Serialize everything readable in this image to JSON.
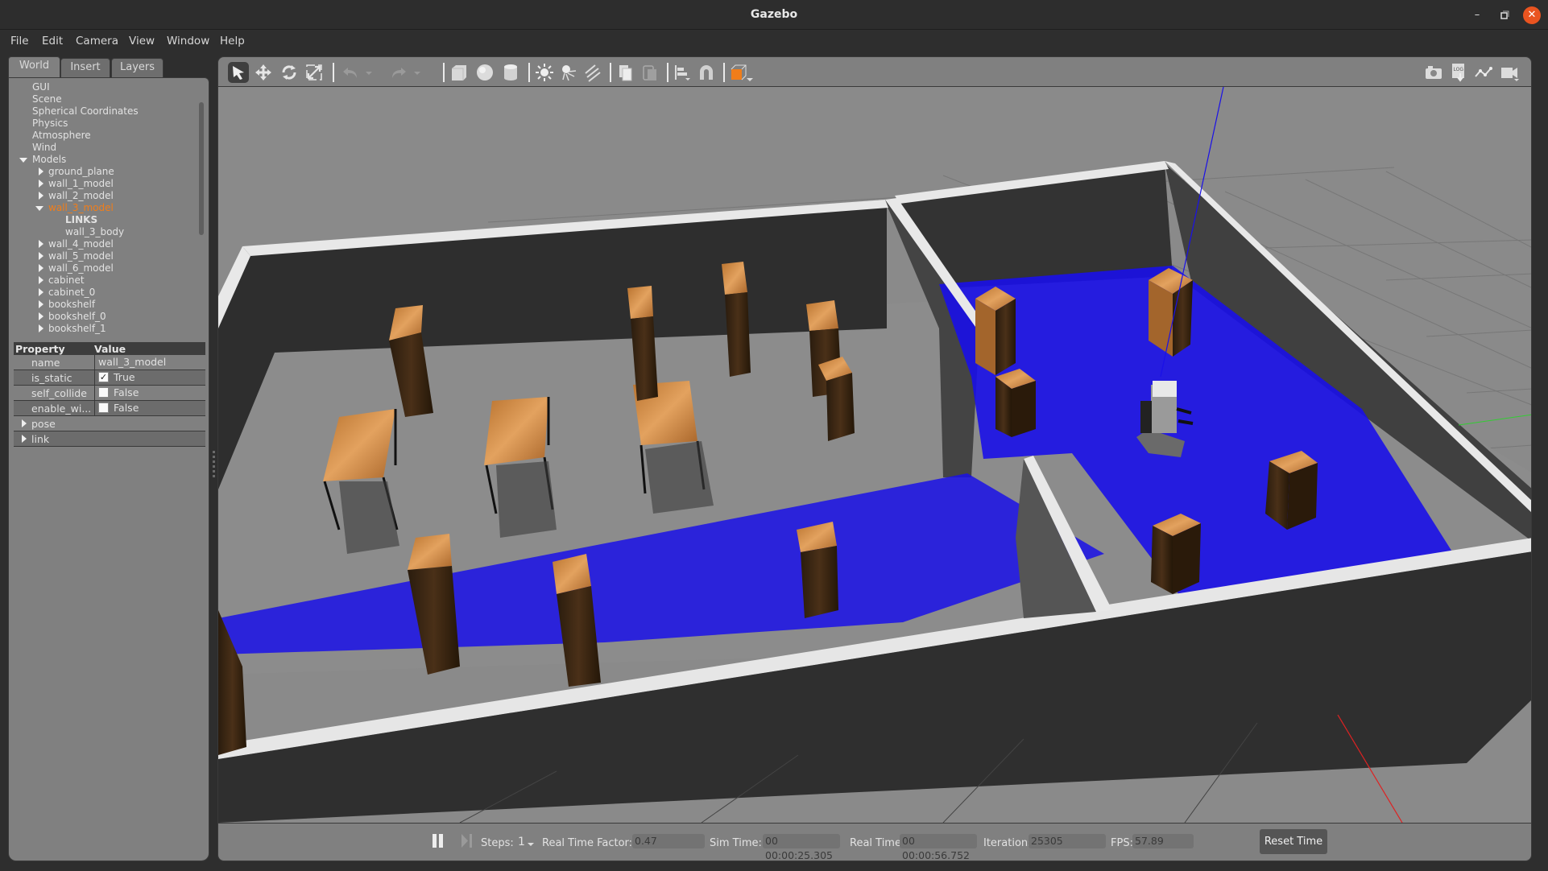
{
  "window": {
    "title": "Gazebo",
    "controls": {
      "minimize": "–",
      "maximize": "▫",
      "close": "✕"
    }
  },
  "menubar": {
    "items": [
      "File",
      "Edit",
      "Camera",
      "View",
      "Window",
      "Help"
    ]
  },
  "left_panel": {
    "tabs": [
      {
        "label": "World",
        "active": true
      },
      {
        "label": "Insert",
        "active": false
      },
      {
        "label": "Layers",
        "active": false
      }
    ],
    "tree": [
      {
        "label": "GUI",
        "level": 0,
        "arrow": "none"
      },
      {
        "label": "Scene",
        "level": 0,
        "arrow": "none"
      },
      {
        "label": "Spherical Coordinates",
        "level": 0,
        "arrow": "none"
      },
      {
        "label": "Physics",
        "level": 0,
        "arrow": "none"
      },
      {
        "label": "Atmosphere",
        "level": 0,
        "arrow": "none"
      },
      {
        "label": "Wind",
        "level": 0,
        "arrow": "none"
      },
      {
        "label": "Models",
        "level": 0,
        "arrow": "down"
      },
      {
        "label": "ground_plane",
        "level": 1,
        "arrow": "right"
      },
      {
        "label": "wall_1_model",
        "level": 1,
        "arrow": "right"
      },
      {
        "label": "wall_2_model",
        "level": 1,
        "arrow": "right"
      },
      {
        "label": "wall_3_model",
        "level": 1,
        "arrow": "down",
        "selected": true
      },
      {
        "label": "LINKS",
        "level": 2,
        "arrow": "none",
        "bold": true
      },
      {
        "label": "wall_3_body",
        "level": 2,
        "arrow": "none"
      },
      {
        "label": "wall_4_model",
        "level": 1,
        "arrow": "right"
      },
      {
        "label": "wall_5_model",
        "level": 1,
        "arrow": "right"
      },
      {
        "label": "wall_6_model",
        "level": 1,
        "arrow": "right"
      },
      {
        "label": "cabinet",
        "level": 1,
        "arrow": "right"
      },
      {
        "label": "cabinet_0",
        "level": 1,
        "arrow": "right"
      },
      {
        "label": "bookshelf",
        "level": 1,
        "arrow": "right"
      },
      {
        "label": "bookshelf_0",
        "level": 1,
        "arrow": "right"
      },
      {
        "label": "bookshelf_1",
        "level": 1,
        "arrow": "right"
      }
    ],
    "properties": {
      "header": {
        "property": "Property",
        "value": "Value"
      },
      "rows": [
        {
          "key": "name",
          "value": "wall_3_model",
          "type": "text"
        },
        {
          "key": "is_static",
          "value": "True",
          "type": "checkbox",
          "checked": true
        },
        {
          "key": "self_collide",
          "value": "False",
          "type": "checkbox",
          "checked": false
        },
        {
          "key": "enable_wi...",
          "value": "False",
          "type": "checkbox",
          "checked": false
        }
      ],
      "groups": [
        "pose",
        "link"
      ]
    }
  },
  "toolbar": {
    "tools": [
      {
        "name": "select-mode",
        "active": true
      },
      {
        "name": "translate-mode"
      },
      {
        "name": "rotate-mode"
      },
      {
        "name": "scale-mode"
      },
      {
        "name": "undo"
      },
      {
        "name": "undo-history"
      },
      {
        "name": "redo"
      },
      {
        "name": "redo-history"
      },
      {
        "name": "box"
      },
      {
        "name": "sphere"
      },
      {
        "name": "cylinder"
      },
      {
        "name": "point-light"
      },
      {
        "name": "spot-light"
      },
      {
        "name": "directional-light"
      },
      {
        "name": "copy"
      },
      {
        "name": "paste"
      },
      {
        "name": "align"
      },
      {
        "name": "snap"
      },
      {
        "name": "view-angle"
      }
    ],
    "right_tools": [
      {
        "name": "screenshot"
      },
      {
        "name": "log"
      },
      {
        "name": "plot"
      },
      {
        "name": "video-record"
      }
    ],
    "colors": {
      "accent_orange": "#f07d1a"
    }
  },
  "scene": {
    "description": "3D world view: room with walls, tables, cabinets, bookshelves and a robot with blue laser scan",
    "colors": {
      "sky": "#8a8a8a",
      "wall_top": "#e8e8e8",
      "wall_side": "#333333",
      "floor": "#8a8a8a",
      "laser": "#1a10e8",
      "wood": "#c67a35"
    }
  },
  "statusbar": {
    "steps_label": "Steps:",
    "steps_value": "1",
    "rtf_label": "Real Time Factor:",
    "rtf_value": "0.47",
    "sim_time_label": "Sim Time:",
    "sim_time_value": "00 00:00:25.305",
    "real_time_label": "Real Time:",
    "real_time_value": "00 00:00:56.752",
    "iterations_label": "Iterations:",
    "iterations_value": "25305",
    "fps_label": "FPS:",
    "fps_value": "57.89",
    "reset_label": "Reset Time"
  }
}
